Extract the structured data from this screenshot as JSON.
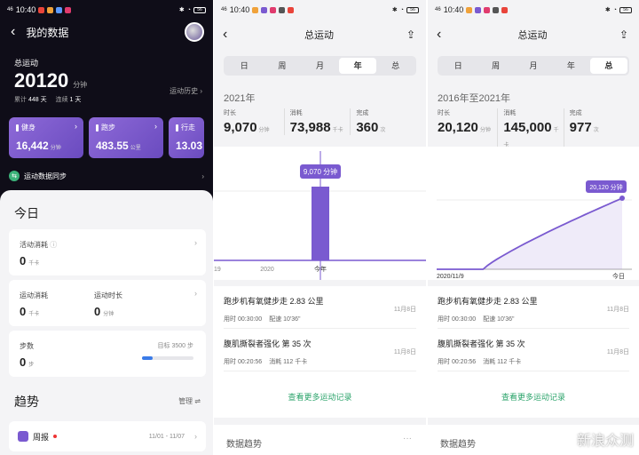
{
  "status": {
    "time": "10:40",
    "network": "46",
    "battery": "56"
  },
  "panel1": {
    "title": "我的数据",
    "total_label": "总运动",
    "total_value": "20120",
    "total_unit": "分钟",
    "cum_label": "累计",
    "cum_value": "448 天",
    "streak_label": "连续",
    "streak_value": "1 天",
    "history_label": "运动历史",
    "cards": [
      {
        "label": "健身",
        "value": "16,442",
        "unit": "分钟"
      },
      {
        "label": "跑步",
        "value": "483.55",
        "unit": "公里"
      },
      {
        "label": "行走",
        "value": "13.03",
        "unit": ""
      }
    ],
    "sync_label": "运动数据同步",
    "today_title": "今日",
    "activity_label": "活动消耗",
    "activity_value": "0",
    "activity_unit": "千卡",
    "sport_cal_label": "运动消耗",
    "sport_cal_value": "0",
    "sport_cal_unit": "千卡",
    "sport_time_label": "运动时长",
    "sport_time_value": "0",
    "sport_time_unit": "分钟",
    "steps_label": "步数",
    "steps_value": "0",
    "steps_unit": "步",
    "steps_goal": "目标 3500 步",
    "steps_progress": 0.2,
    "trend_title": "趋势",
    "manage_label": "管理",
    "weekly_label": "周报",
    "weekly_dates": "11/01 - 11/07"
  },
  "panel2": {
    "title": "总运动",
    "tabs": [
      "日",
      "周",
      "月",
      "年",
      "总"
    ],
    "active_tab": 3,
    "range": "2021年",
    "stats": [
      {
        "label": "时长",
        "value": "9,070",
        "unit": "分钟"
      },
      {
        "label": "消耗",
        "value": "73,988",
        "unit": "千卡"
      },
      {
        "label": "完成",
        "value": "360",
        "unit": "次"
      }
    ],
    "chart_tooltip": "9,070 分钟",
    "x_labels": [
      "19",
      "2020",
      "今年"
    ]
  },
  "panel3": {
    "title": "总运动",
    "tabs": [
      "日",
      "周",
      "月",
      "年",
      "总"
    ],
    "active_tab": 4,
    "range": "2016年至2021年",
    "stats": [
      {
        "label": "时长",
        "value": "20,120",
        "unit": "分钟"
      },
      {
        "label": "消耗",
        "value": "145,000",
        "unit": "千卡"
      },
      {
        "label": "完成",
        "value": "977",
        "unit": "次"
      }
    ],
    "chart_tooltip": "20,120 分钟",
    "x_labels": [
      "2020/11/9",
      "今日"
    ]
  },
  "records": [
    {
      "title": "跑步机有氧健步走 2.83 公里",
      "dur": "用时 00:30:00",
      "pace": "配速 10'36\"",
      "date": "11月8日"
    },
    {
      "title": "腹肌撕裂者强化 第 35 次",
      "dur": "用时 00:20:56",
      "pace": "消耗 112 千卡",
      "date": "11月8日"
    }
  ],
  "more_label": "查看更多运动记录",
  "trend_label": "数据趋势",
  "watermark": "新浪众测",
  "chart_data": [
    {
      "type": "bar",
      "categories": [
        "19",
        "2020",
        "今年"
      ],
      "values": [
        0,
        0,
        9070
      ],
      "ylabel": "",
      "xlabel": ""
    },
    {
      "type": "line",
      "x": [
        "2020/11/9",
        "今日"
      ],
      "values": [
        0,
        20120
      ],
      "xlabel": "",
      "ylabel": ""
    }
  ]
}
